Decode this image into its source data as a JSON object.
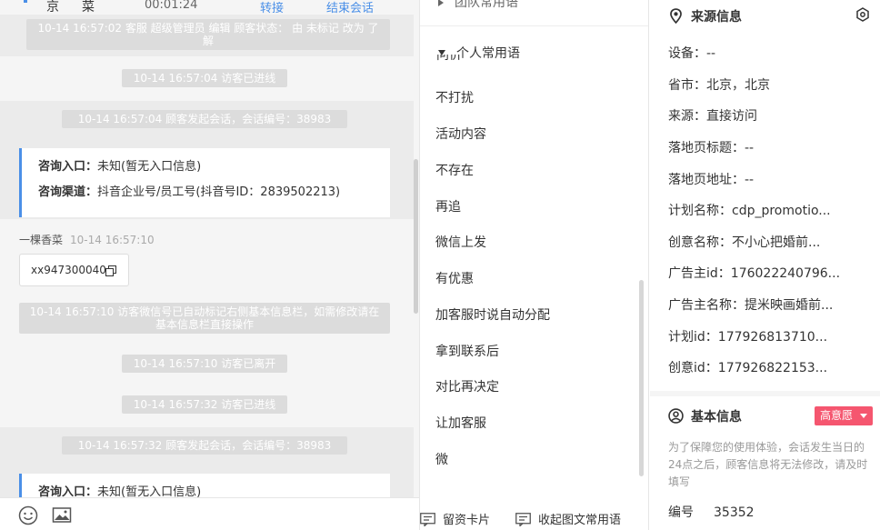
{
  "chat_header": {
    "name_part1": "京",
    "name_part2": "菜",
    "duration": "00:01:24",
    "transfer_label": "转接",
    "end_label": "结束会话"
  },
  "system_messages": [
    "10-14 16:57:02 客服 超级管理员 编辑 顾客状态： 由 未标记 改为 了解",
    "10-14 16:57:04 访客已进线",
    "10-14 16:57:04 顾客发起会话，会话编号：38983",
    "10-14 16:57:10 访客微信号已自动标记右侧基本信息栏，如需修改请在基本信息栏直接操作",
    "10-14 16:57:10 访客已离开",
    "10-14 16:57:32 访客已进线",
    "10-14 16:57:32 顾客发起会话，会话编号：38983"
  ],
  "consult_card": {
    "entry_label": "咨询入口：",
    "entry_value": "未知(暂无入口信息)",
    "channel_label": "咨询渠道：",
    "channel_value": "抖音企业号/员工号(抖音号ID：2839502213)"
  },
  "visitor_message": {
    "sender": "一棵香菜",
    "time": "10-14 16:57:10",
    "text": "xx947300040"
  },
  "phrases": {
    "team_group": "团队常用语",
    "personal_group": "个人常用语",
    "cut_item": "问价格",
    "items": [
      "不打扰",
      "活动内容",
      "不存在",
      "再追",
      "微信上发",
      "有优惠",
      "加客服时说自动分配",
      "拿到联系后",
      "对比再决定",
      "让加客服",
      "微"
    ],
    "footer_card": "留资卡片",
    "footer_collapse": "收起图文常用语"
  },
  "source_info": {
    "title": "来源信息",
    "rows": [
      {
        "label": "设备：",
        "value": "--"
      },
      {
        "label": "省市：",
        "value": "北京，北京"
      },
      {
        "label": "来源：",
        "value": "直接访问"
      },
      {
        "label": "落地页标题：",
        "value": "--"
      },
      {
        "label": "落地页地址：",
        "value": "--"
      },
      {
        "label": "计划名称：",
        "value": "cdp_promotio..."
      },
      {
        "label": "创意名称：",
        "value": "不小心把婚前..."
      },
      {
        "label": "广告主id：",
        "value": "176022240796..."
      },
      {
        "label": "广告主名称：",
        "value": "提米映画婚前..."
      },
      {
        "label": "计划id：",
        "value": "177926813710..."
      },
      {
        "label": "创意id：",
        "value": "177926822153..."
      }
    ]
  },
  "basic_info": {
    "title": "基本信息",
    "intent_badge": "高意愿",
    "note": "为了保障您的使用体验，会话发生当日的24点之后，顾客信息将无法修改，请及时填写",
    "id_label": "编号",
    "id_value": "35352"
  },
  "colors": {
    "accent": "#4a8fe7",
    "badge": "#f5566f",
    "system_bubble": "#dcdcdc"
  }
}
